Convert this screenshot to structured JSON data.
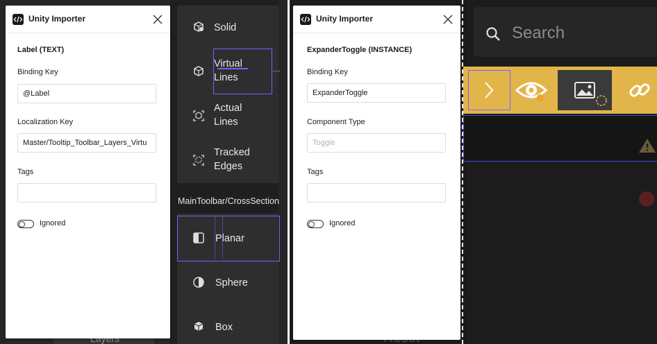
{
  "left": {
    "panel": {
      "app_title": "Unity Importer",
      "section_title": "Label (TEXT)",
      "binding_key_label": "Binding Key",
      "binding_key_value": "@Label",
      "localization_key_label": "Localization Key",
      "localization_key_value": "Master/Tooltip_Toolbar_Layers_Virtu",
      "tags_label": "Tags",
      "tags_value": "",
      "ignored_label": "Ignored"
    },
    "canvas": {
      "menu_items": [
        {
          "label": "Solid",
          "icon": "solid-cube-icon"
        },
        {
          "label_line1": "Virtual",
          "label_line2": "Lines",
          "icon": "cube-outline-icon"
        },
        {
          "label_line1": "Actual",
          "label_line2": "Lines",
          "icon": "actual-lines-icon"
        },
        {
          "label_line1": "Tracked",
          "label_line2": "Edges",
          "icon": "tracked-edges-icon"
        }
      ],
      "cross_section_label": "MainToolbar/CrossSection",
      "cross_items": [
        {
          "label": "Planar",
          "icon": "planar-icon"
        },
        {
          "label": "Sphere",
          "icon": "sphere-icon"
        },
        {
          "label": "Box",
          "icon": "box-icon"
        }
      ],
      "partial_e": "e",
      "partial_layers": "Layers"
    }
  },
  "right": {
    "panel": {
      "app_title": "Unity Importer",
      "section_title": "ExpanderToggle (INSTANCE)",
      "binding_key_label": "Binding Key",
      "binding_key_value": "ExpanderToggle",
      "component_type_label": "Component Type",
      "component_type_placeholder": "Toggle",
      "tags_label": "Tags",
      "tags_value": "",
      "ignored_label": "Ignored"
    },
    "canvas": {
      "search_placeholder": "Search",
      "partial_reset": "Reset",
      "toolbar_color": "#e2b54a",
      "selection_color": "#7b61ff",
      "frame_color": "#3d4cd9"
    }
  }
}
